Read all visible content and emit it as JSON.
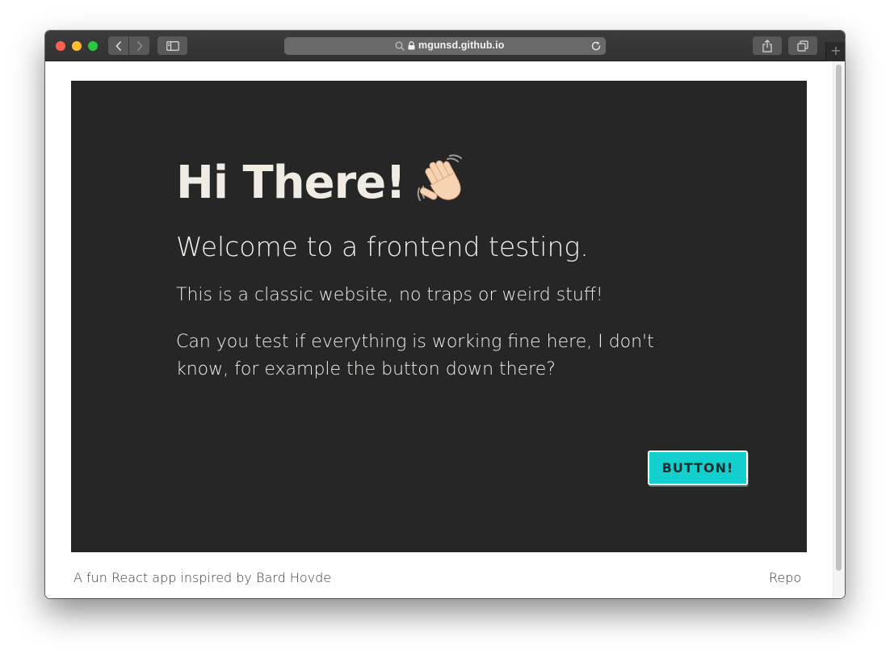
{
  "browser": {
    "url": "mgunsd.github.io",
    "new_tab_symbol": "+",
    "traffic_lights": {
      "close_color": "#fe5f57",
      "minimize_color": "#febc2e",
      "maximize_color": "#28c840"
    },
    "icons": {
      "back": "chevron-left-icon",
      "forward": "chevron-right-icon",
      "sidebar": "sidebar-icon",
      "search": "search-icon",
      "lock": "lock-icon",
      "reload": "reload-icon",
      "share": "share-icon",
      "tabs": "tabs-overview-icon"
    }
  },
  "page": {
    "hero": {
      "title": "Hi There!",
      "title_emoji_icon": "waving-hand-icon",
      "subtitle": "Welcome to a frontend testing.",
      "paragraph_1": "This is a classic website, no traps or weird stuff!",
      "paragraph_2": "Can you test if everything is working fine here, I don't know, for example the button down there?",
      "button_label": "BUTTON!",
      "background_color": "#272627",
      "button_color": "#13d0cf"
    },
    "footer": {
      "left_text": "A fun React app inspired by Bard Hovde",
      "right_link": "Repo"
    }
  }
}
